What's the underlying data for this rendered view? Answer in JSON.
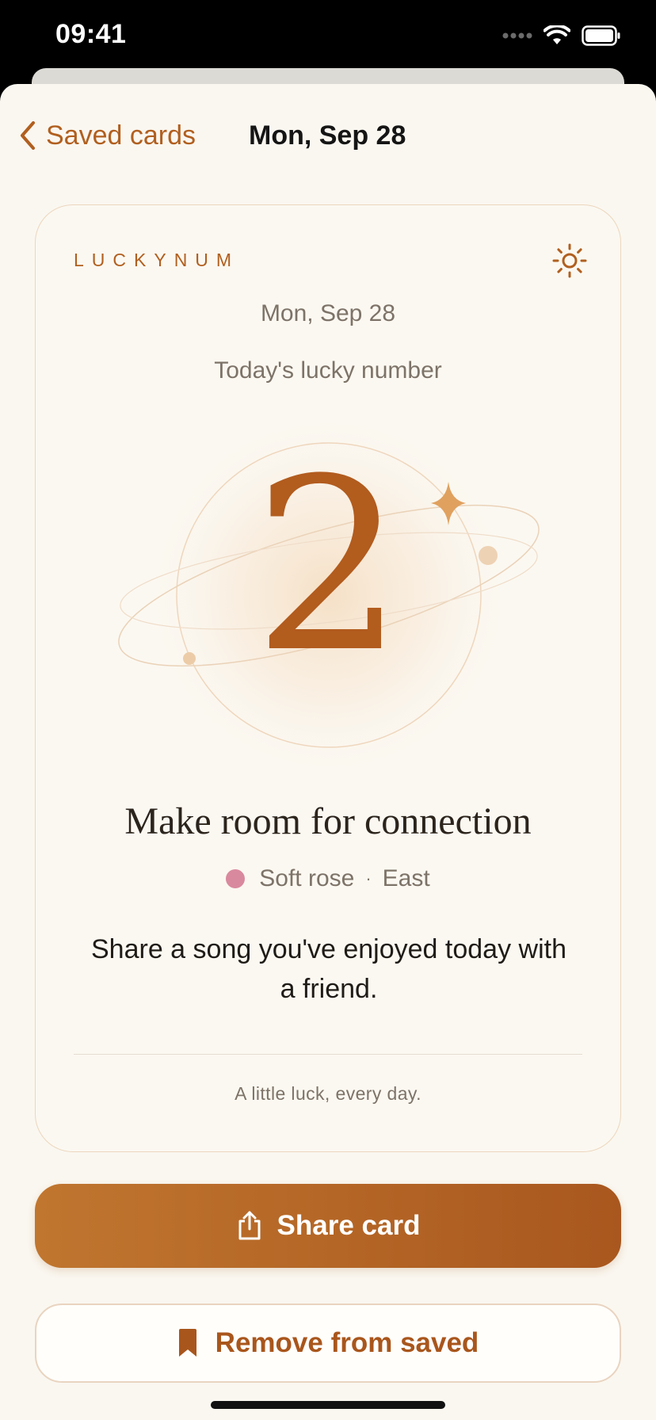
{
  "status_bar": {
    "time": "09:41",
    "icons": [
      "signal-icon",
      "wifi-icon",
      "battery-icon"
    ]
  },
  "nav": {
    "back_label": "Saved cards",
    "title": "Mon, Sep 28"
  },
  "card": {
    "brand": "LUCKYNUM",
    "theme_icon": "sun-icon",
    "date": "Mon, Sep 28",
    "subtitle": "Today's lucky number",
    "number": "2",
    "headline": "Make room for connection",
    "lucky_color_name": "Soft rose",
    "lucky_color_hex": "#d9899e",
    "separator": "·",
    "direction": "East",
    "body": "Share a song you've enjoyed today with a friend.",
    "footer": "A little luck, every day."
  },
  "actions": {
    "share_label": "Share card",
    "share_icon": "share-icon",
    "remove_label": "Remove from saved",
    "remove_icon": "bookmark-icon"
  },
  "colors": {
    "accent": "#b15f1f",
    "background": "#faf7f0"
  }
}
